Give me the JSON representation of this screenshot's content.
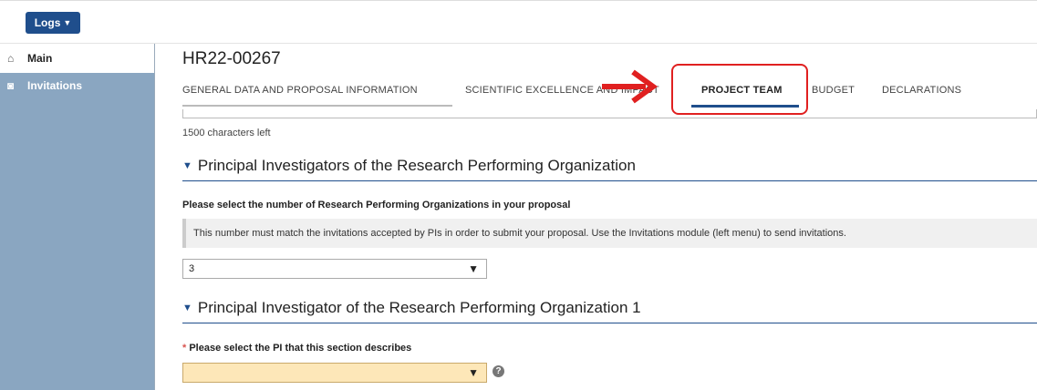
{
  "topbar": {
    "logs_label": "Logs"
  },
  "sidebar": {
    "items": [
      {
        "label": "Main",
        "icon": "home-icon"
      },
      {
        "label": "Invitations",
        "icon": "invitations-icon"
      }
    ]
  },
  "page": {
    "title": "HR22-00267"
  },
  "tabs": [
    {
      "label": "GENERAL DATA AND PROPOSAL INFORMATION"
    },
    {
      "label": "SCIENTIFIC EXCELLENCE AND IMPACT"
    },
    {
      "label": "PROJECT TEAM",
      "active": true
    },
    {
      "label": "BUDGET"
    },
    {
      "label": "DECLARATIONS"
    }
  ],
  "form": {
    "chars_left": "1500 characters left",
    "section1_title": "Principal Investigators of the Research Performing Organization",
    "rpo_count_label": "Please select the number of Research Performing Organizations in your proposal",
    "notice": "This number must match the invitations accepted by PIs in order to submit your proposal. Use the Invitations module (left menu) to send invitations.",
    "rpo_count_value": "3",
    "section2_title": "Principal Investigator of the Research Performing Organization 1",
    "required_mark": "*",
    "pi_select_label": "Please select the PI that this section describes",
    "pi_select_value": ""
  },
  "colors": {
    "accent": "#1f4e8c",
    "sidebar": "#8aa6c1",
    "highlight": "#e02020",
    "required_field": "#fde7b8"
  }
}
